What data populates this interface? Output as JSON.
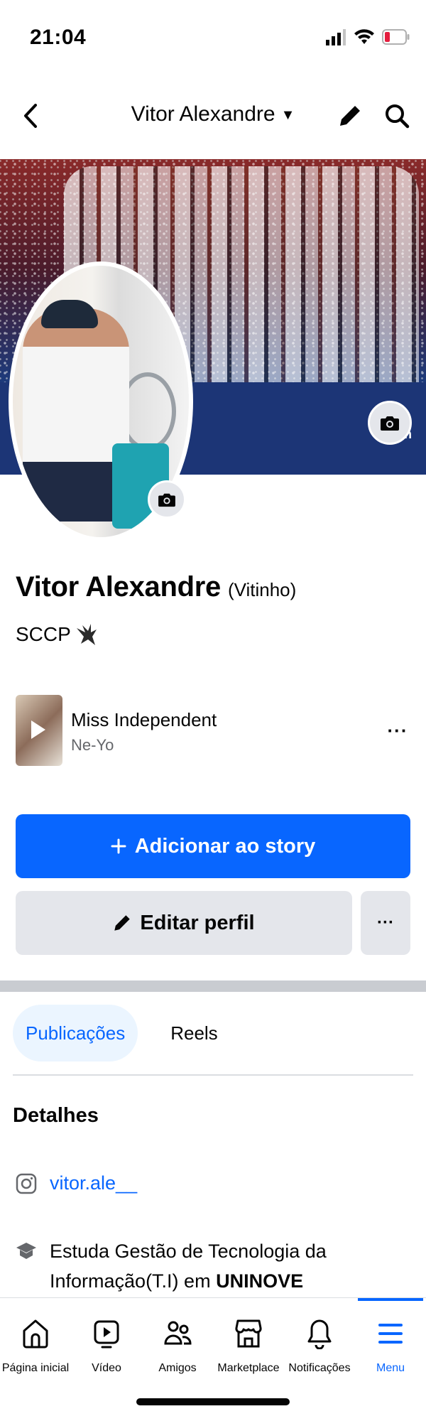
{
  "status_bar": {
    "time": "21:04"
  },
  "header": {
    "title": "Vitor Alexandre"
  },
  "cover": {
    "stage_text": "ation"
  },
  "profile": {
    "name": "Vitor Alexandre",
    "nickname": "(Vitinho)",
    "bio": "SCCP"
  },
  "music": {
    "title": "Miss Independent",
    "artist": "Ne-Yo"
  },
  "actions": {
    "add_story": "Adicionar ao story",
    "edit_profile": "Editar perfil",
    "more": "···"
  },
  "tabs": [
    {
      "label": "Publicações",
      "active": true
    },
    {
      "label": "Reels",
      "active": false
    }
  ],
  "details": {
    "title": "Detalhes",
    "instagram": "vitor.ale__",
    "education_prefix": "Estuda Gestão de Tecnologia da Informação(T.I) em",
    "education_school": "UNINOVE"
  },
  "bottom_nav": [
    {
      "label": "Página inicial",
      "icon": "home-icon"
    },
    {
      "label": "Vídeo",
      "icon": "video-icon"
    },
    {
      "label": "Amigos",
      "icon": "friends-icon"
    },
    {
      "label": "Marketplace",
      "icon": "marketplace-icon"
    },
    {
      "label": "Notificações",
      "icon": "bell-icon"
    },
    {
      "label": "Menu",
      "icon": "menu-icon",
      "active": true
    }
  ],
  "colors": {
    "accent": "#0866ff",
    "button_gray": "#e4e6eb",
    "battery_low": "#e41e3f"
  }
}
